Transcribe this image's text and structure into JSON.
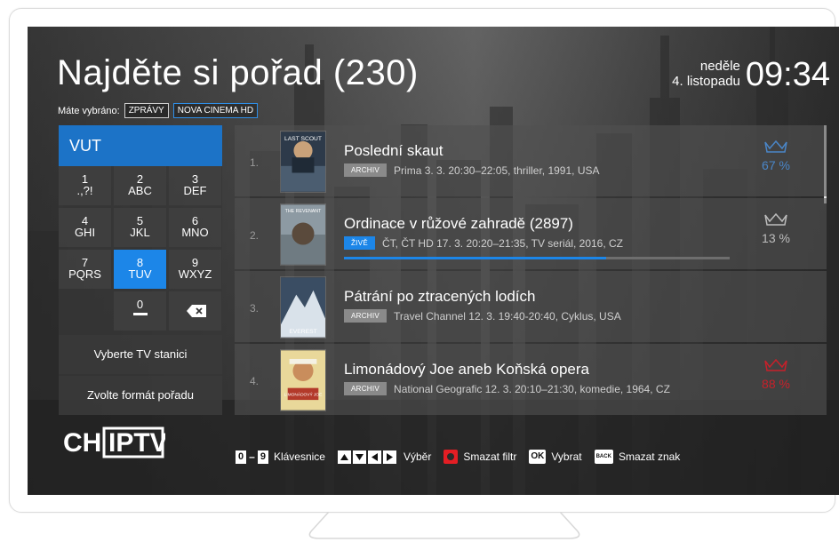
{
  "header": {
    "title": "Najděte si pořad (230)",
    "day": "neděle",
    "date": "4. listopadu",
    "time": "09:34"
  },
  "filters": {
    "label": "Máte vybráno:",
    "chips": [
      "ZPRÁVY",
      "NOVA CINEMA HD"
    ]
  },
  "keypad": {
    "query": "VUT",
    "keys": [
      {
        "num": "1",
        "letters": ".,?!"
      },
      {
        "num": "2",
        "letters": "ABC"
      },
      {
        "num": "3",
        "letters": "DEF"
      },
      {
        "num": "4",
        "letters": "GHI"
      },
      {
        "num": "5",
        "letters": "JKL"
      },
      {
        "num": "6",
        "letters": "MNO"
      },
      {
        "num": "7",
        "letters": "PQRS"
      },
      {
        "num": "8",
        "letters": "TUV"
      },
      {
        "num": "9",
        "letters": "WXYZ"
      },
      {
        "num": "0",
        "letters": ""
      }
    ],
    "active_key": "8",
    "station_button": "Vyberte TV stanici",
    "format_button": "Zvolte formát pořadu"
  },
  "results": [
    {
      "index": "1.",
      "title": "Poslední skaut",
      "badge": "ARCHIV",
      "meta": "Prima 3. 3. 20:30–22:05, thriller, 1991, USA",
      "rating": "67 %",
      "rating_color": "#4a86c8"
    },
    {
      "index": "2.",
      "title": "Ordinace v růžové zahradě (2897)",
      "badge": "ŽIVĚ",
      "meta": "ČT, ČT HD 17. 3. 20:20–21:35, TV seriál, 2016, CZ",
      "rating": "13 %",
      "rating_color": "#bdbdbd",
      "progress": 0.68
    },
    {
      "index": "3.",
      "title": "Pátrání po ztracených lodích",
      "badge": "ARCHIV",
      "meta": "Travel Channel 12. 3. 19:40-20:40, Cyklus, USA",
      "rating": "",
      "rating_color": ""
    },
    {
      "index": "4.",
      "title": "Limonádový Joe aneb Koňská opera",
      "badge": "ARCHIV",
      "meta": "National Geografic 12. 3. 20:10–21:30, komedie, 1964, CZ",
      "rating": "88 %",
      "rating_color": "#c8202a"
    }
  ],
  "posters": [
    {
      "text": "LAST SCOUT",
      "icon": "poster-last-scout"
    },
    {
      "text": "THE REVENANT",
      "icon": "poster-revenant"
    },
    {
      "text": "EVEREST",
      "icon": "poster-everest"
    },
    {
      "text": "LIMONÁDOVÝ JOE",
      "icon": "poster-limonadovy-joe"
    }
  ],
  "logo": {
    "text": "CH IPTV"
  },
  "legend": {
    "keys_from": "0",
    "keys_to": "9",
    "keyboard": "Klávesnice",
    "select": "Výběr",
    "clear_filter": "Smazat filtr",
    "ok": "OK",
    "choose": "Vybrat",
    "back": "BACK",
    "delete_char": "Smazat znak"
  },
  "colors": {
    "accent": "#1c86e8",
    "search": "#1c73c7",
    "red": "#e31e24"
  }
}
